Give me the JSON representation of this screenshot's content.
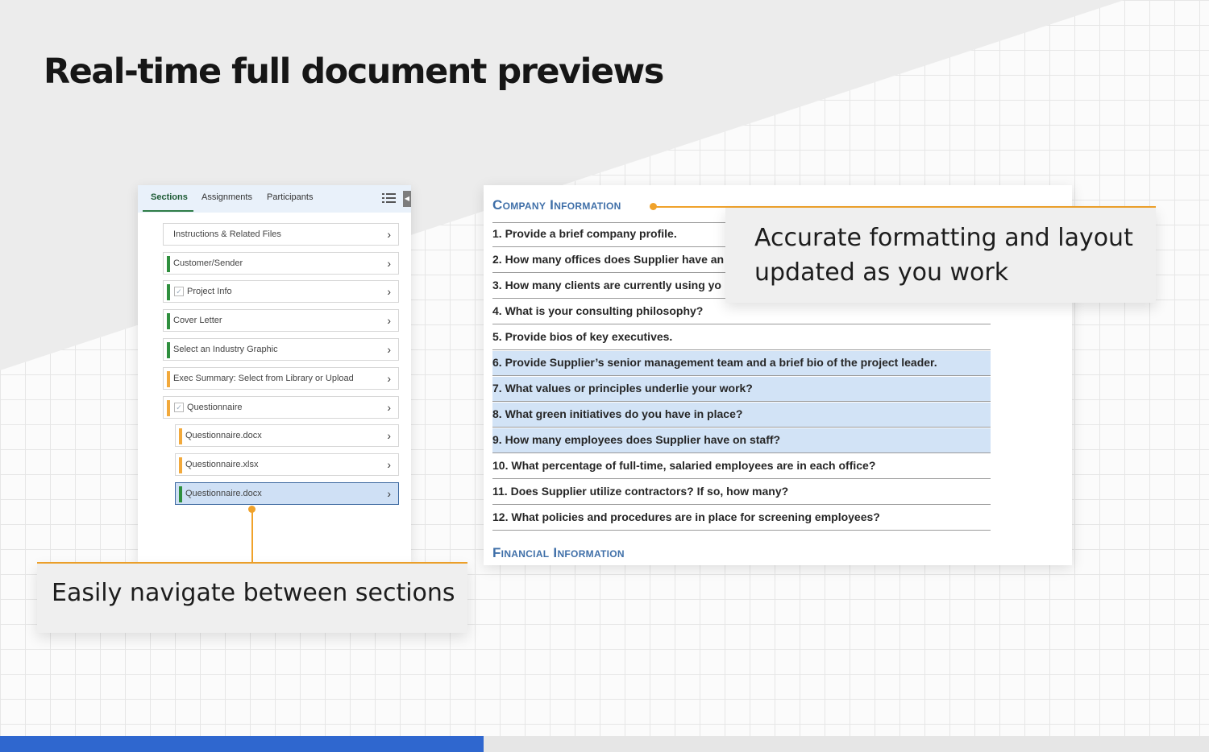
{
  "headline": "Real-time full document previews",
  "panel": {
    "tabs": [
      {
        "label": "Sections",
        "active": true
      },
      {
        "label": "Assignments",
        "active": false
      },
      {
        "label": "Participants",
        "active": false
      }
    ],
    "items": [
      {
        "label": "Instructions & Related Files",
        "bar_color": "",
        "checkbox": false,
        "indent": 0,
        "selected": false
      },
      {
        "label": "Customer/Sender",
        "bar_color": "#2f8f3e",
        "checkbox": false,
        "indent": 0,
        "selected": false
      },
      {
        "label": "Project Info",
        "bar_color": "#2f8f3e",
        "checkbox": true,
        "indent": 0,
        "selected": false
      },
      {
        "label": "Cover Letter",
        "bar_color": "#2f8f3e",
        "checkbox": false,
        "indent": 0,
        "selected": false
      },
      {
        "label": "Select an Industry Graphic",
        "bar_color": "#2f8f3e",
        "checkbox": false,
        "indent": 0,
        "selected": false
      },
      {
        "label": "Exec Summary: Select from Library or Upload",
        "bar_color": "#f2a93b",
        "checkbox": false,
        "indent": 0,
        "selected": false
      },
      {
        "label": "Questionnaire",
        "bar_color": "#f2a93b",
        "checkbox": true,
        "indent": 0,
        "selected": false
      },
      {
        "label": "Questionnaire.docx",
        "bar_color": "#f2a93b",
        "checkbox": false,
        "indent": 1,
        "selected": false
      },
      {
        "label": "Questionnaire.xlsx",
        "bar_color": "#f2a93b",
        "checkbox": false,
        "indent": 1,
        "selected": false
      },
      {
        "label": "Questionnaire.docx",
        "bar_color": "#2f8f3e",
        "checkbox": false,
        "indent": 1,
        "selected": true
      }
    ]
  },
  "document": {
    "section1": "Company Information",
    "questions": [
      {
        "text": "1. Provide a brief company profile.",
        "highlighted": false
      },
      {
        "text": "2. How many offices does Supplier have an",
        "highlighted": false
      },
      {
        "text": "3. How many clients are currently using yo",
        "highlighted": false
      },
      {
        "text": "4. What is your consulting philosophy?",
        "highlighted": false
      },
      {
        "text": "5. Provide bios of key executives.",
        "highlighted": false
      },
      {
        "text": "6. Provide Supplier’s senior management team and a brief bio of the project leader.",
        "highlighted": true
      },
      {
        "text": "7. What values or principles underlie your work?",
        "highlighted": true
      },
      {
        "text": "8. What green initiatives do you have in place?",
        "highlighted": true
      },
      {
        "text": "9. How many employees does Supplier have on staff?",
        "highlighted": true
      },
      {
        "text": "10. What percentage of full-time, salaried employees are in each office?",
        "highlighted": false
      },
      {
        "text": "11. Does Supplier utilize contractors?  If so, how many?",
        "highlighted": false
      },
      {
        "text": "12. What policies and procedures are in place for screening employees?",
        "highlighted": false
      }
    ],
    "section2": "Financial Information"
  },
  "callouts": {
    "right_line1": "Accurate formatting and layout",
    "right_line2": "updated as you work",
    "left": "Easily navigate between sections"
  },
  "colors": {
    "accent": "#f0a22a",
    "heading_blue": "#3f6fa8",
    "highlight": "#d2e3f6",
    "bottom_bar": "#2f67cf"
  }
}
